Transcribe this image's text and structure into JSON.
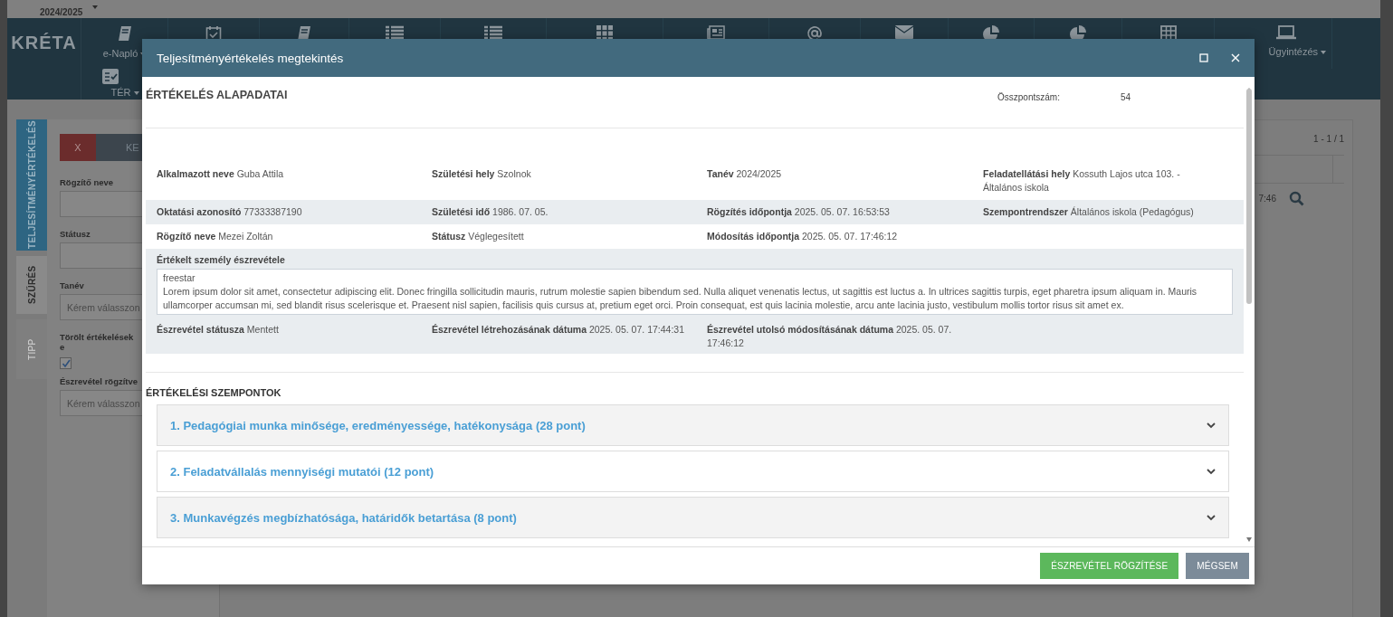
{
  "top_bar": {
    "school_year": "2024/2025"
  },
  "header": {
    "logo": "KRÉTA",
    "nav": [
      {
        "label": "e-Napló"
      },
      {
        "label": "Ügyintézés"
      }
    ],
    "nav_row2": [
      {
        "label": "TÉR"
      }
    ]
  },
  "side_tabs": [
    {
      "label": "TELJESÍTMÉNYÉRTÉKELÉS",
      "kind": "title"
    },
    {
      "label": "SZŰRÉS",
      "kind": "tab",
      "selected": true
    },
    {
      "label": "TIPP",
      "kind": "tab",
      "selected": false
    }
  ],
  "filter": {
    "buttons": [
      {
        "label": "X",
        "kind": "danger"
      },
      {
        "label": "KE",
        "kind": "default"
      }
    ],
    "fields": [
      {
        "label": "Rögzítő neve",
        "kind": "text"
      },
      {
        "label": "Státusz",
        "kind": "text"
      },
      {
        "label": "Tanév",
        "kind": "select",
        "placeholder": "Kérem válasszon"
      },
      {
        "label": "Törölt értékelések e",
        "kind": "checkbox",
        "checked": true
      },
      {
        "label": "Észrevétel rögzítve",
        "kind": "select",
        "placeholder": "Kérem válasszon"
      }
    ]
  },
  "results": {
    "pager": "1 - 1 / 1",
    "cell_fragment": "7:46"
  },
  "modal": {
    "title": "Teljesítményértékelés megtekintés",
    "basic": {
      "heading": "ÉRTÉKELÉS ALAPADATAI",
      "total_label": "Összpontszám:",
      "total_value": "54",
      "rows": [
        [
          {
            "label": "Alkalmazott neve",
            "value": "Guba Attila"
          },
          {
            "label": "Születési hely",
            "value": "Szolnok"
          },
          {
            "label": "Tanév",
            "value": "2024/2025"
          },
          {
            "label": "Feladatellátási hely",
            "value": "Kossuth Lajos utca 103. - Általános iskola"
          }
        ],
        [
          {
            "label": "Oktatási azonosító",
            "value": "77333387190"
          },
          {
            "label": "Születési idő",
            "value": "1986. 07. 05."
          },
          {
            "label": "Rögzítés időpontja",
            "value": "2025. 05. 07. 16:53:53"
          },
          {
            "label": "Szempontrendszer",
            "value": "Általános iskola (Pedagógus)"
          }
        ],
        [
          {
            "label": "Rögzítő neve",
            "value": "Mezei Zoltán"
          },
          {
            "label": "Státusz",
            "value": "Véglegesített"
          },
          {
            "label": "Módosítás időpontja",
            "value": "2025. 05. 07. 17:46:12"
          }
        ]
      ],
      "comment_label": "Értékelt személy észrevétele",
      "comment": "freestar\nLorem ipsum dolor sit amet, consectetur adipiscing elit. Donec fringilla sollicitudin mauris, rutrum molestie sapien bibendum sed. Nulla aliquet venenatis lectus, ut sagittis est luctus a. In ultrices sagittis turpis, eget pharetra ipsum aliquam in. Mauris ullamcorper accumsan mi, sed blandit risus scelerisque et. Praesent nisl sapien, facilisis quis cursus at, pretium eget orci. Proin consequat, est quis lacinia molestie, arcu ante lacinia justo, vestibulum mollis tortor risus sit amet ex.",
      "comment_rows": [
        [
          {
            "label": "Észrevétel státusza",
            "value": "Mentett"
          },
          {
            "label": "Észrevétel létrehozásának dátuma",
            "value": "2025. 05. 07. 17:44:31"
          },
          {
            "label": "Észrevétel utolsó módosításának dátuma",
            "value": "2025. 05. 07. 17:46:12"
          }
        ]
      ]
    },
    "criteria": {
      "heading": "ÉRTÉKELÉSI SZEMPONTOK",
      "items": [
        {
          "title": "1. Pedagógiai munka minősége, eredményessége, hatékonysága (28 pont)",
          "expanded": false
        },
        {
          "title": "2. Feladatvállalás mennyiségi mutatói (12 pont)",
          "expanded": false
        },
        {
          "title": "3. Munkavégzés megbízhatósága, határidők betartása (8 pont)",
          "expanded": false
        }
      ]
    },
    "buttons": [
      {
        "label": "ÉSZREVÉTEL RÖGZÍTÉSE",
        "kind": "primary"
      },
      {
        "label": "MÉGSEM",
        "kind": "secondary"
      }
    ]
  }
}
